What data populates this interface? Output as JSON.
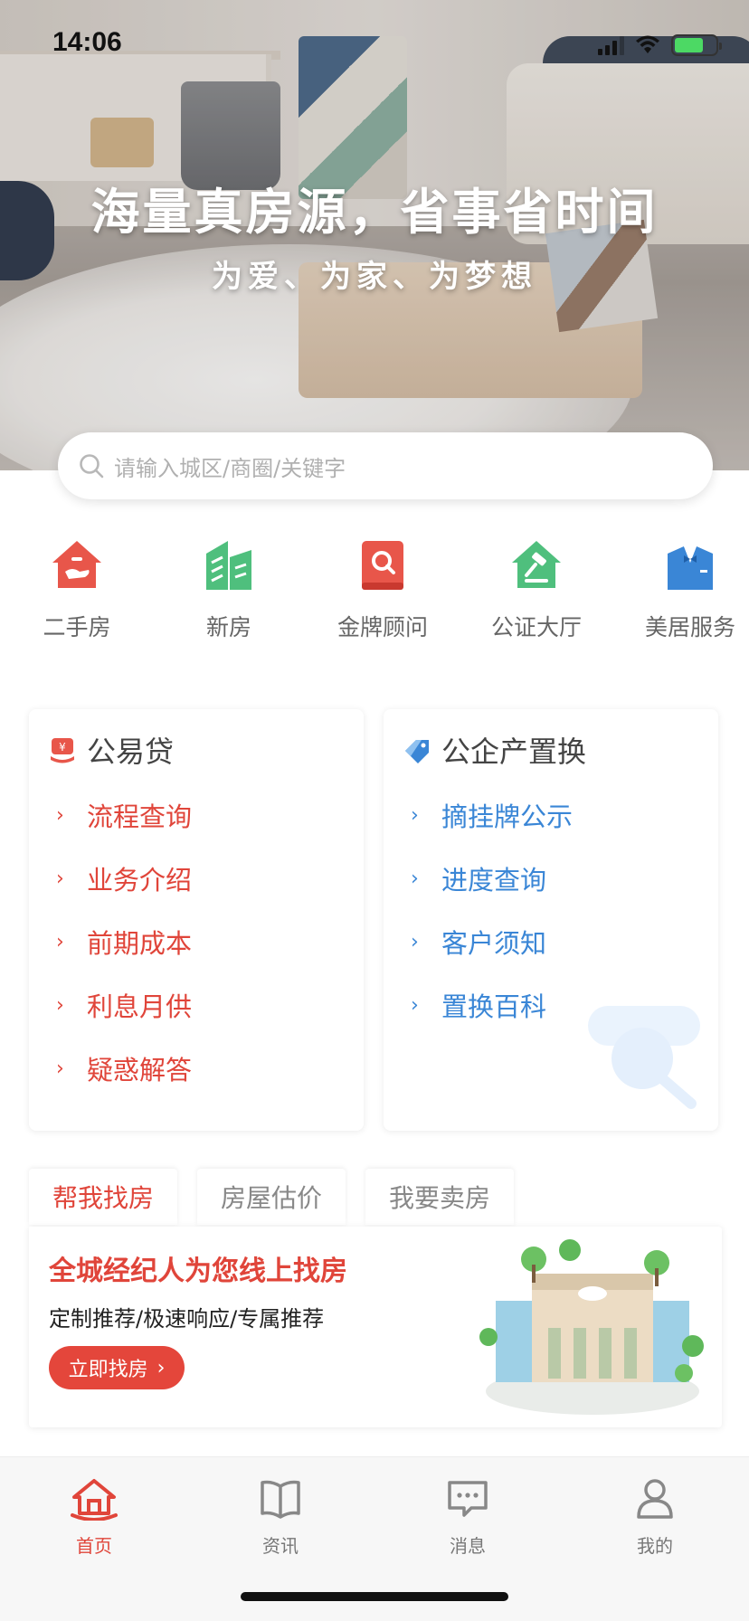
{
  "status_bar": {
    "time": "14:06"
  },
  "banner": {
    "title": "海量真房源，省事省时间",
    "subtitle": "为爱、为家、为梦想"
  },
  "search": {
    "placeholder": "请输入城区/商圈/关键字"
  },
  "categories": [
    {
      "label": "二手房",
      "icon": "house-hand-icon",
      "color": "#e8564a"
    },
    {
      "label": "新房",
      "icon": "buildings-icon",
      "color": "#4fbf7d"
    },
    {
      "label": "金牌顾问",
      "icon": "book-search-icon",
      "color": "#e8564a"
    },
    {
      "label": "公证大厅",
      "icon": "gavel-house-icon",
      "color": "#4fbf7d"
    },
    {
      "label": "美居服务",
      "icon": "suit-bowtie-icon",
      "color": "#3a86d6"
    }
  ],
  "cards": {
    "loan": {
      "title": "公易贷",
      "items": [
        "流程查询",
        "业务介绍",
        "前期成本",
        "利息月供",
        "疑惑解答"
      ]
    },
    "exchange": {
      "title": "公企产置换",
      "items": [
        "摘挂牌公示",
        "进度查询",
        "客户须知",
        "置换百科"
      ]
    }
  },
  "tabs": [
    {
      "label": "帮我找房",
      "active": true
    },
    {
      "label": "房屋估价",
      "active": false
    },
    {
      "label": "我要卖房",
      "active": false
    }
  ],
  "find_panel": {
    "headline": "全城经纪人为您线上找房",
    "desc": "定制推荐/极速响应/专属推荐",
    "button": "立即找房"
  },
  "tab_bar": [
    {
      "label": "首页",
      "icon": "home-icon",
      "active": true
    },
    {
      "label": "资讯",
      "icon": "book-icon",
      "active": false
    },
    {
      "label": "消息",
      "icon": "message-icon",
      "active": false
    },
    {
      "label": "我的",
      "icon": "user-icon",
      "active": false
    }
  ],
  "colors": {
    "accent_red": "#e0453a",
    "accent_blue": "#3a86d6",
    "accent_green": "#4fbf7d"
  }
}
